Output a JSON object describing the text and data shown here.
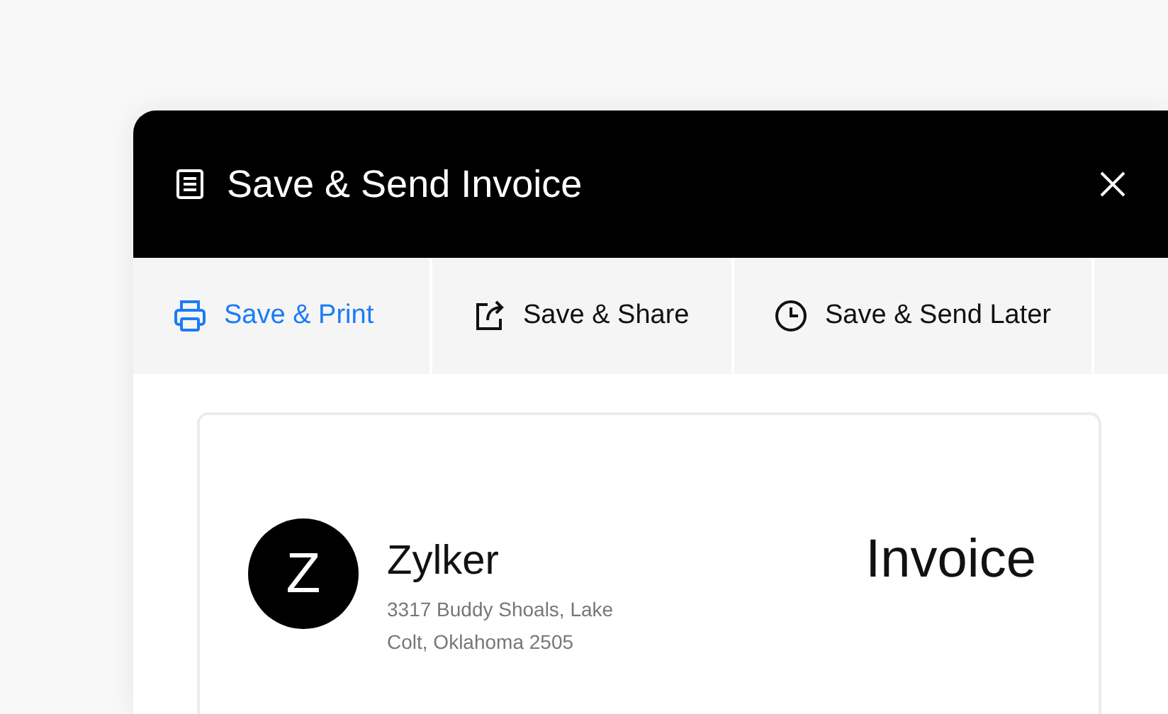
{
  "dialog": {
    "title": "Save & Send Invoice"
  },
  "tabs": [
    {
      "label": "Save & Print",
      "kind": "print",
      "selected": true
    },
    {
      "label": "Save & Share",
      "kind": "share",
      "selected": false
    },
    {
      "label": "Save & Send Later",
      "kind": "later",
      "selected": false
    }
  ],
  "invoice": {
    "logo_letter": "Z",
    "company": "Zylker",
    "address": "3317 Buddy Shoals, Lake Colt, Oklahoma 2505",
    "heading": "Invoice"
  }
}
